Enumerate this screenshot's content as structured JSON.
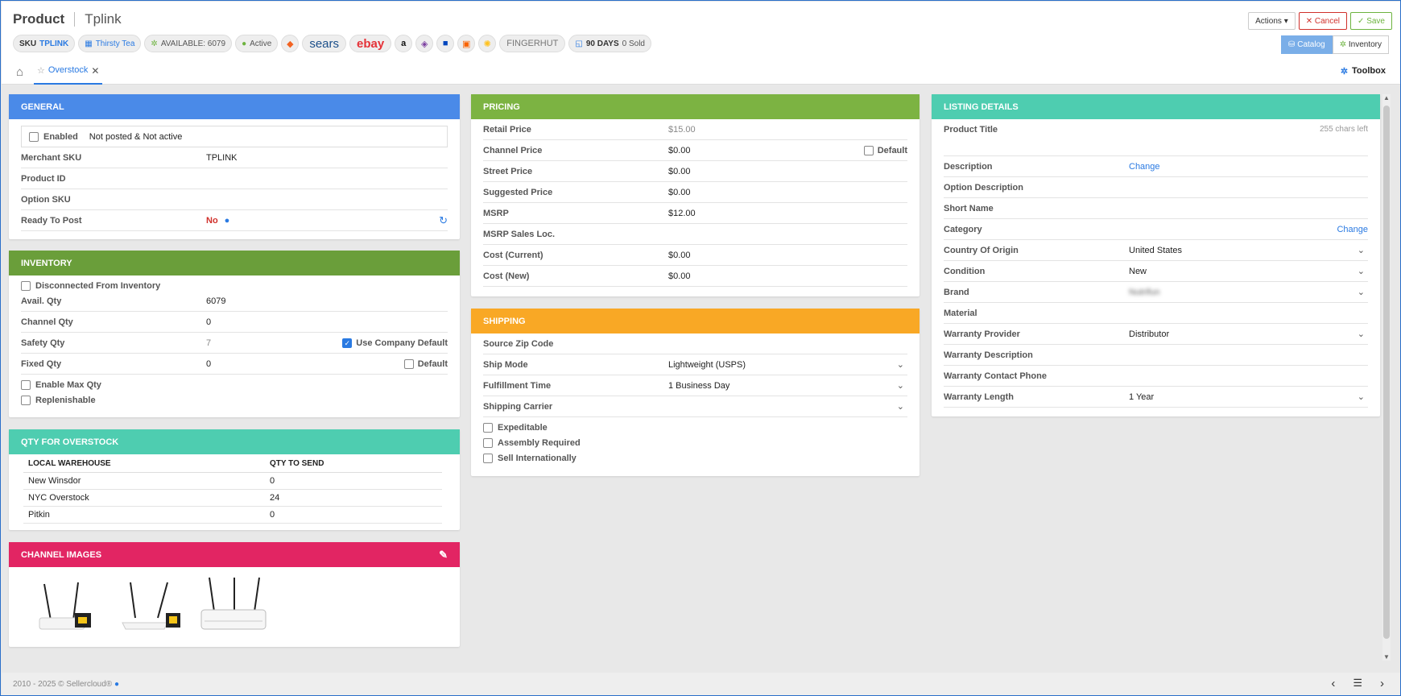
{
  "header": {
    "title": "Product",
    "name": "Tplink",
    "badges": {
      "sku_label": "SKU",
      "sku_value": "TPLINK",
      "company": "Thirsty Tea",
      "available": "AVAILABLE: 6079",
      "status": "Active",
      "days": "90 DAYS",
      "sold": "0 Sold"
    },
    "logos": {
      "sears": "sears",
      "ebay": "ebay",
      "amazon": "a",
      "fingerhut": "FINGERHUT"
    },
    "actions": {
      "actions": "Actions",
      "cancel": "Cancel",
      "save": "Save"
    },
    "views": {
      "catalog": "Catalog",
      "inventory": "Inventory"
    }
  },
  "tabs": {
    "overstock": "Overstock",
    "toolbox": "Toolbox"
  },
  "general": {
    "title": "GENERAL",
    "enabled_label": "Enabled",
    "enabled_status": "Not posted & Not active",
    "rows": [
      {
        "label": "Merchant SKU",
        "value": "TPLINK"
      },
      {
        "label": "Product ID",
        "value": ""
      },
      {
        "label": "Option SKU",
        "value": ""
      },
      {
        "label": "Ready To Post",
        "value": "No"
      }
    ]
  },
  "inventory": {
    "title": "INVENTORY",
    "disconnected": "Disconnected From Inventory",
    "rows": [
      {
        "label": "Avail. Qty",
        "value": "6079"
      },
      {
        "label": "Channel Qty",
        "value": "0"
      },
      {
        "label": "Safety Qty",
        "value": "7"
      },
      {
        "label": "Fixed Qty",
        "value": "0"
      }
    ],
    "use_company_default": "Use Company Default",
    "default": "Default",
    "enable_max": "Enable Max Qty",
    "replenishable": "Replenishable"
  },
  "overstock": {
    "title": "QTY FOR OVERSTOCK",
    "col1": "LOCAL WAREHOUSE",
    "col2": "QTY TO SEND",
    "rows": [
      {
        "w": "New Winsdor",
        "q": "0"
      },
      {
        "w": "NYC Overstock",
        "q": "24"
      },
      {
        "w": "Pitkin",
        "q": "0"
      }
    ]
  },
  "images": {
    "title": "CHANNEL IMAGES"
  },
  "pricing": {
    "title": "PRICING",
    "default": "Default",
    "rows": [
      {
        "label": "Retail Price",
        "value": "$15.00"
      },
      {
        "label": "Channel Price",
        "value": "$0.00"
      },
      {
        "label": "Street Price",
        "value": "$0.00"
      },
      {
        "label": "Suggested Price",
        "value": "$0.00"
      },
      {
        "label": "MSRP",
        "value": "$12.00"
      },
      {
        "label": "MSRP Sales Loc.",
        "value": ""
      },
      {
        "label": "Cost (Current)",
        "value": "$0.00"
      },
      {
        "label": "Cost (New)",
        "value": "$0.00"
      }
    ]
  },
  "shipping": {
    "title": "SHIPPING",
    "rows": [
      {
        "label": "Source Zip Code",
        "value": ""
      },
      {
        "label": "Ship Mode",
        "value": "Lightweight (USPS)"
      },
      {
        "label": "Fulfillment Time",
        "value": "1 Business Day"
      },
      {
        "label": "Shipping Carrier",
        "value": ""
      }
    ],
    "expeditable": "Expeditable",
    "assembly": "Assembly Required",
    "intl": "Sell Internationally"
  },
  "listing": {
    "title": "LISTING DETAILS",
    "product_title": "Product Title",
    "chars_left": "255 chars left",
    "change": "Change",
    "rows": [
      {
        "label": "Description",
        "value": "Change"
      },
      {
        "label": "Option Description",
        "value": ""
      },
      {
        "label": "Short Name",
        "value": ""
      },
      {
        "label": "Category",
        "value": ""
      },
      {
        "label": "Country Of Origin",
        "value": "United States"
      },
      {
        "label": "Condition",
        "value": "New"
      },
      {
        "label": "Brand",
        "value": "Nutrifun"
      },
      {
        "label": "Material",
        "value": ""
      },
      {
        "label": "Warranty Provider",
        "value": "Distributor"
      },
      {
        "label": "Warranty Description",
        "value": ""
      },
      {
        "label": "Warranty Contact Phone",
        "value": ""
      },
      {
        "label": "Warranty Length",
        "value": "1 Year"
      }
    ]
  },
  "footer": {
    "copyright": "2010 - 2025 © Sellercloud®"
  },
  "colors": {
    "general": "#4a8ae8",
    "inventory": "#6a9e3a",
    "overstock": "#4ecdb0",
    "images": "#e22563",
    "pricing": "#7cb342",
    "shipping": "#f9a825",
    "listing": "#4ecdb0"
  }
}
